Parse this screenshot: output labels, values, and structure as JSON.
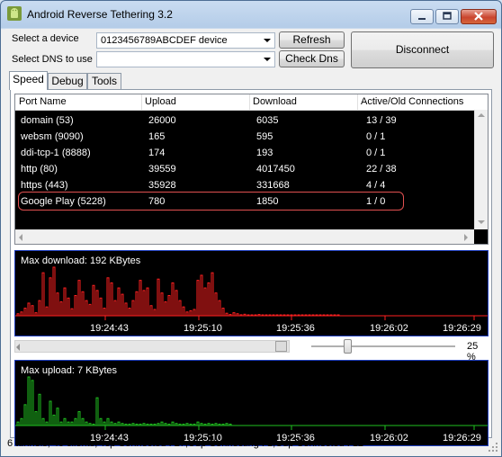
{
  "window": {
    "title": "Android Reverse Tethering 3.2"
  },
  "device": {
    "label": "Select a device",
    "value": "0123456789ABCDEF  device"
  },
  "dns": {
    "label": "Select DNS to use",
    "value": ""
  },
  "buttons": {
    "refresh": "Refresh",
    "check_dns": "Check Dns",
    "disconnect": "Disconnect"
  },
  "tabs": [
    "Speed",
    "Debug",
    "Tools"
  ],
  "table": {
    "headers": [
      "Port Name",
      "Upload",
      "Download",
      "Active/Old Connections"
    ],
    "rows": [
      [
        "domain (53)",
        "26000",
        "6035",
        "13 / 39"
      ],
      [
        "websm (9090)",
        "165",
        "595",
        "0 / 1"
      ],
      [
        "ddi-tcp-1 (8888)",
        "174",
        "193",
        "0 / 1"
      ],
      [
        "http (80)",
        "39559",
        "4017450",
        "22 / 38"
      ],
      [
        "https (443)",
        "35928",
        "331668",
        "4 / 4"
      ],
      [
        "Google Play (5228)",
        "780",
        "1850",
        "1 / 0"
      ]
    ]
  },
  "download_chart": {
    "title": "Max download: 192 KBytes",
    "times": [
      "19:24:43",
      "19:25:10",
      "19:25:36",
      "19:26:02",
      "19:26:29"
    ]
  },
  "upload_chart": {
    "title": "Max upload: 7 KBytes",
    "times": [
      "19:24:43",
      "19:25:10",
      "19:25:36",
      "19:26:02",
      "19:26:29"
    ]
  },
  "zoom": {
    "value": "25 %",
    "fraction": 0.25
  },
  "status": "6 tunnels, 40 clients, Tcp Connected : 27,Udp Connecting : 1,Udp Connected : 12",
  "colors": {
    "download": "#ff2020",
    "upload": "#20c020",
    "grid": "#000000"
  },
  "chart_data": [
    {
      "type": "bar",
      "title": "Max download: 192 KBytes",
      "x": [
        "19:24:43",
        "19:25:10",
        "19:25:36",
        "19:26:02",
        "19:26:29"
      ],
      "unit": "KBytes",
      "ylim": [
        0,
        192
      ],
      "values": [
        8,
        15,
        30,
        50,
        40,
        12,
        60,
        170,
        35,
        150,
        192,
        90,
        55,
        110,
        70,
        28,
        80,
        140,
        95,
        60,
        45,
        120,
        100,
        70,
        30,
        150,
        130,
        60,
        110,
        85,
        50,
        30,
        60,
        95,
        140,
        100,
        110,
        40,
        25,
        145,
        90,
        55,
        80,
        130,
        100,
        60,
        35,
        15,
        20,
        25,
        140,
        160,
        110,
        130,
        170,
        90,
        60,
        30,
        10,
        5,
        12,
        8,
        4,
        6,
        3,
        2,
        3,
        5,
        2,
        3,
        2,
        1,
        2,
        3,
        2,
        2,
        1,
        2,
        1,
        2,
        1,
        1,
        1,
        1,
        1,
        1,
        1,
        1,
        1,
        1
      ]
    },
    {
      "type": "bar",
      "title": "Max upload: 7 KBytes",
      "x": [
        "19:24:43",
        "19:25:10",
        "19:25:36",
        "19:26:02",
        "19:26:29"
      ],
      "unit": "KBytes",
      "ylim": [
        0,
        7
      ],
      "values": [
        0.5,
        1,
        3,
        7,
        6.5,
        2,
        4.5,
        1,
        0.5,
        3.5,
        1.5,
        2.5,
        0.5,
        1,
        0.5,
        0.5,
        1,
        2,
        1,
        0.5,
        0.3,
        0.2,
        4,
        1,
        0.5,
        1,
        0.5,
        0.3,
        0.5,
        0.3,
        0.2,
        0.2,
        0.3,
        0.2,
        0.2,
        0.3,
        0.2,
        0.2,
        0.2,
        0.3,
        0.5,
        0.3,
        0.2,
        0.5,
        0.3,
        0.2,
        0.2,
        0.3,
        0.2,
        0.2,
        0.5,
        0.3,
        0.2,
        0.3,
        0.2,
        0.3,
        0.2,
        0.2,
        0.3,
        0.2
      ]
    }
  ]
}
